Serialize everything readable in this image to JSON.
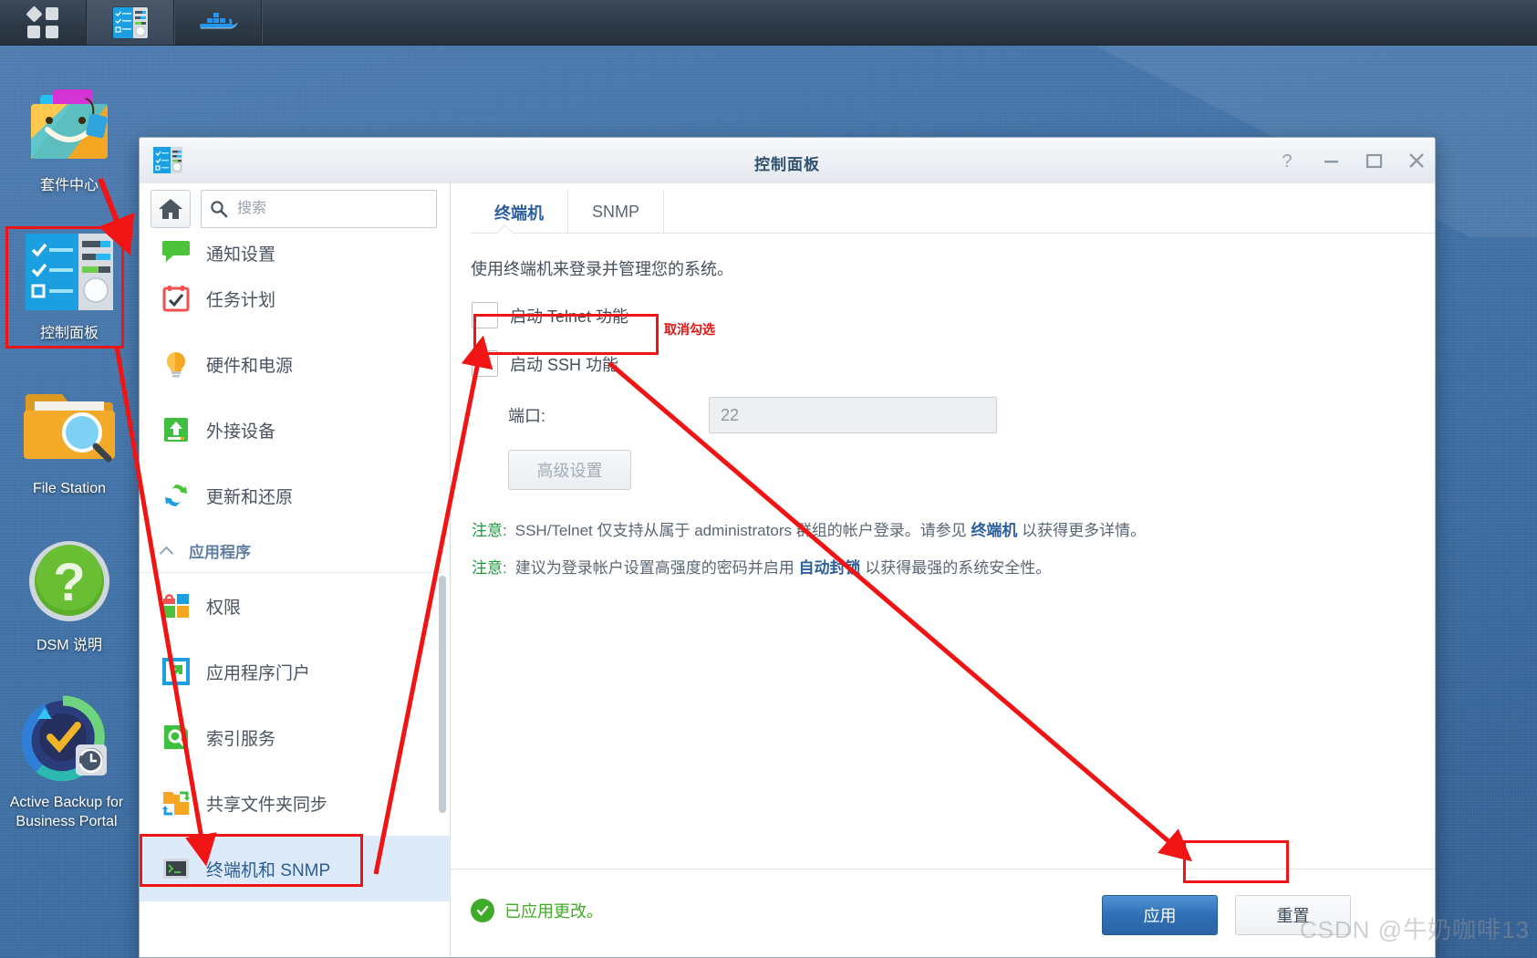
{
  "taskbar": {
    "items": [
      {
        "name": "main-menu",
        "icon": "app-grid-icon",
        "label": ""
      },
      {
        "name": "control-panel",
        "icon": "control-panel-icon",
        "label": ""
      },
      {
        "name": "docker",
        "icon": "docker-whale-icon",
        "label": ""
      }
    ]
  },
  "desktop": {
    "icons": [
      {
        "label": "套件中心",
        "icon": "package-center-icon"
      },
      {
        "label": "控制面板",
        "icon": "control-panel-icon"
      },
      {
        "label": "File Station",
        "icon": "file-station-icon"
      },
      {
        "label": "DSM 说明",
        "icon": "dsm-help-icon"
      },
      {
        "label": "Active Backup for Business Portal",
        "icon": "active-backup-icon"
      }
    ]
  },
  "window": {
    "title": "控制面板",
    "controls": {
      "help": "?",
      "minimize": "–",
      "maximize": "□",
      "close": "×"
    }
  },
  "sidebar": {
    "home_label": "主页",
    "search_placeholder": "搜索",
    "search_value": "",
    "items": [
      {
        "label": "通知设置",
        "icon": "notification-icon"
      },
      {
        "label": "任务计划",
        "icon": "task-scheduler-icon"
      },
      {
        "label": "硬件和电源",
        "icon": "hardware-power-icon"
      },
      {
        "label": "外接设备",
        "icon": "external-devices-icon"
      },
      {
        "label": "更新和还原",
        "icon": "update-restore-icon"
      }
    ],
    "group_label": "应用程序",
    "app_items": [
      {
        "label": "权限",
        "icon": "privileges-icon"
      },
      {
        "label": "应用程序门户",
        "icon": "application-portal-icon"
      },
      {
        "label": "索引服务",
        "icon": "indexing-service-icon"
      },
      {
        "label": "共享文件夹同步",
        "icon": "shared-folder-sync-icon"
      },
      {
        "label": "终端机和 SNMP",
        "icon": "terminal-snmp-icon",
        "selected": true
      }
    ]
  },
  "main": {
    "tabs": [
      {
        "label": "终端机",
        "active": true
      },
      {
        "label": "SNMP",
        "active": false
      }
    ],
    "description": "使用终端机来登录并管理您的系统。",
    "telnet_label": "启动 Telnet 功能",
    "telnet_checked": false,
    "ssh_label": "启动 SSH 功能",
    "ssh_checked": false,
    "port_label": "端口:",
    "port_value": "22",
    "advanced_button": "高级设置",
    "notes": [
      {
        "prefix": "注意:",
        "text1": "SSH/Telnet 仅支持从属于 administrators 群组的帐户登录。请参见 ",
        "link": "终端机",
        "text2": " 以获得更多详情。"
      },
      {
        "prefix": "注意:",
        "text1": "建议为登录帐户设置高强度的密码并启用 ",
        "link": "自动封锁",
        "text2": " 以获得最强的系统安全性。"
      }
    ]
  },
  "footer": {
    "status": "已应用更改。",
    "apply_label": "应用",
    "reset_label": "重置"
  },
  "annotations": {
    "uncheck_hint": "取消勾选"
  },
  "watermark": "CSDN @牛奶咖啡13",
  "colors": {
    "accent": "#2d5f9e",
    "annotation_red": "#f01414",
    "success_green": "#3faa27",
    "selected_bg": "#dceafa"
  }
}
